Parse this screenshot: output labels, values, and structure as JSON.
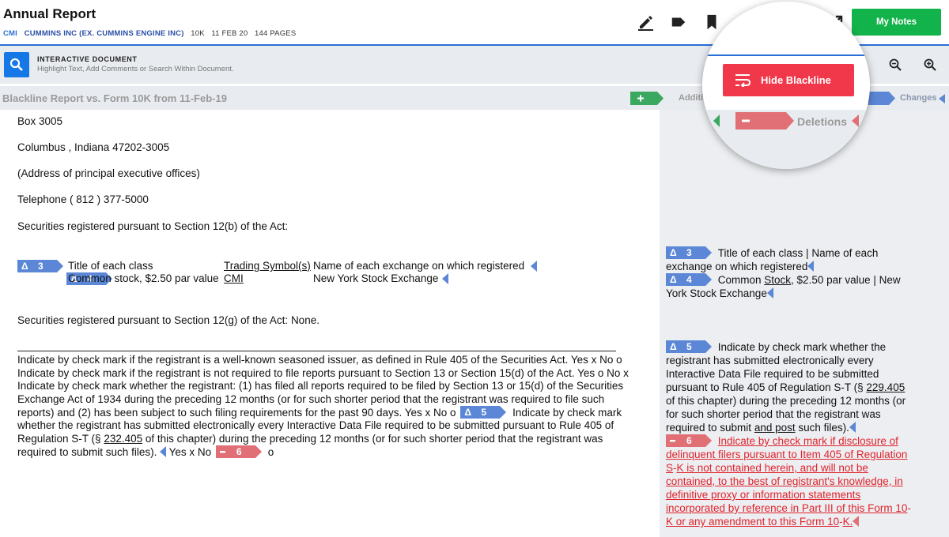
{
  "header": {
    "title": "Annual Report",
    "ticker": "CMI",
    "company": "CUMMINS INC (EX. CUMMINS ENGINE INC)",
    "form": "10K",
    "date": "11 FEB 20",
    "pages": "144 PAGES",
    "my_notes_label": "My Notes"
  },
  "toolbar": {
    "icons": [
      "pencil-icon",
      "tag-icon",
      "bookmark-icon",
      "people-icon",
      "printer-icon",
      "export-icon"
    ]
  },
  "interactive": {
    "title": "INTERACTIVE DOCUMENT",
    "subtitle": "Highlight Text, Add Comments or Search Within Document."
  },
  "blackline": {
    "title": "Blackline Report vs. Form 10K from 11-Feb-19",
    "additions_label": "Additi",
    "changes_label": "Changes",
    "hide_label": "Hide Blackline",
    "deletions_label": "Deletions"
  },
  "colors": {
    "accent_blue": "#2a6fd6",
    "green": "#12b34a",
    "change_blue": "#5b87d6",
    "delete_red": "#e07075",
    "hide_red": "#f0384a",
    "red_text": "#e0242d"
  },
  "left_doc": {
    "line1": "Box 3005",
    "line2": "Columbus , Indiana 47202-3005",
    "line3": "(Address of principal executive offices)",
    "line4": "Telephone ( 812 ) 377-5000",
    "line5": "Securities registered pursuant to Section 12(b) of the Act:",
    "tag3": "3",
    "tag4": "4",
    "col1_head": "Title of each class",
    "col2_head": "Trading Symbol(s)",
    "col3_head": "Name of each exchange on which registered",
    "col1_val": "Common stock, $2.50 par value",
    "col2_val": "CMI",
    "col3_val": "New York Stock Exchange",
    "line6": "Securities registered pursuant to Section 12(g) of the Act: None.",
    "p1": "Indicate by check mark if the registrant is a well-known seasoned issuer, as defined in Rule 405 of the Securities Act. Yes x No o",
    "p2": "Indicate by check mark if the registrant is not required to file reports pursuant to Section 13 or Section 15(d) of the Act. Yes o No x",
    "p3": "Indicate by check mark whether the registrant: (1) has filed all reports required to be filed by Section 13 or 15(d) of the Securities",
    "p4": "Exchange Act of 1934 during the preceding 12 months (or for such shorter period that the registrant was required to file such",
    "p5a": "reports) and (2) has been subject to such filing requirements for the past 90 days. Yes x No o",
    "tag5": "5",
    "p5b": "Indicate by check mark",
    "p6": "whether the registrant has submitted electronically every Interactive Data File required to be submitted pursuant to Rule 405 of",
    "p7a": "Regulation S-T (§ ",
    "p7b": "232.405",
    "p7c": " of this chapter) during the preceding 12 months (or for such shorter period that the registrant was",
    "p8a": "required to submit such files).",
    "p8b": "Yes x No",
    "tag6": "6",
    "p8c": "o"
  },
  "right_panel": {
    "r3a": "Title of each class | Name of each",
    "r3b": "exchange on which registered",
    "r4a": "Common ",
    "r4b": "Stock",
    "r4c": ", $2.50 par value | New",
    "r4d": "York Stock Exchange",
    "r5a": "Indicate by check mark whether the",
    "r5b": "registrant has submitted electronically every",
    "r5c": "Interactive Data File required to be submitted",
    "r5d1": "pursuant to Rule 405 of Regulation S-T (§ ",
    "r5d2": "229.405",
    "r5e": "of this chapter) during the preceding 12 months (or",
    "r5f": "for such shorter period that the registrant was",
    "r5g1": "required to submit ",
    "r5g2": "and post",
    "r5g3": " such files).",
    "r6a": "Indicate by check mark if disclosure of",
    "r6b": "delinquent filers pursuant to Item 405 of Regulation",
    "r6c1": "S",
    "r6c2": "-",
    "r6c3": "K is not contained herein, and will not be",
    "r6d": "contained, to the best of registrant's knowledge, in",
    "r6e": "definitive proxy or information statements",
    "r6f1": "incorporated by reference in Part III of this Form 10",
    "r6f2": "-",
    "r6g1": "K or any amendment to this Form 10",
    "r6g2": "-",
    "r6g3": "K."
  }
}
